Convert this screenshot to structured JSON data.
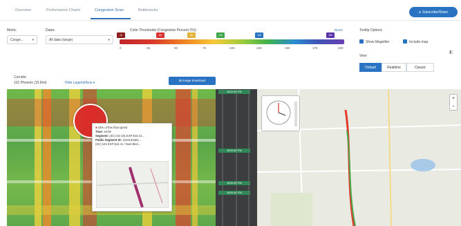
{
  "tabs": [
    {
      "label": "Overview"
    },
    {
      "label": "Performance Charts"
    },
    {
      "label": "Congestion Scan"
    },
    {
      "label": "Bottlenecks"
    }
  ],
  "subscribe_label": "Subscribe/Share",
  "controls": {
    "metric_label": "Metric",
    "metric_value": "Conge...",
    "dates_label": "Dates",
    "dates_value": "All data (range)",
    "thresholds_label": "Color Thresholds (Congestion Percent (%))",
    "reset_label": "Reset",
    "scale_ticks": [
      "0",
      "25",
      "50",
      "75",
      "100",
      "125",
      "150",
      "175",
      "200"
    ],
    "markers": [
      "40",
      "60",
      "80",
      "100",
      "130",
      "190"
    ],
    "tooltip_options_label": "Tooltip Options",
    "show_magnifier": "Show Magnifier",
    "include_map": "Include map",
    "view_label": "View",
    "view_options": [
      "Default",
      "Realtime",
      "Classic"
    ],
    "active_view": "Default"
  },
  "corridor": {
    "label": "Corridor",
    "name": "101 Phoenix (15.8mi)",
    "hide_link": "Hide Legend/Axis ▾",
    "export_label": "⊞ Image download"
  },
  "tooltip": {
    "headline": "24% of free flow speed",
    "time_label": "Time:",
    "time_value": "16:00",
    "segment_label": "Segment:",
    "segment_value": "(SC) I10 101 EXP Exit 41...",
    "public_label": "Public Segment ID:",
    "public_value": "1234123461...",
    "extra": "(SC) 101 EXP Exit 41 / Next Blvd..."
  },
  "strip_labels": [
    "08:00 AM PM",
    "08:00 AM PM",
    "08:00 AM PM",
    "08:00 AM PM"
  ],
  "colors": {
    "accent": "#2a73c2",
    "hot": "#dd2828",
    "moderate": "#f0c43a",
    "free": "#5fae4b"
  }
}
